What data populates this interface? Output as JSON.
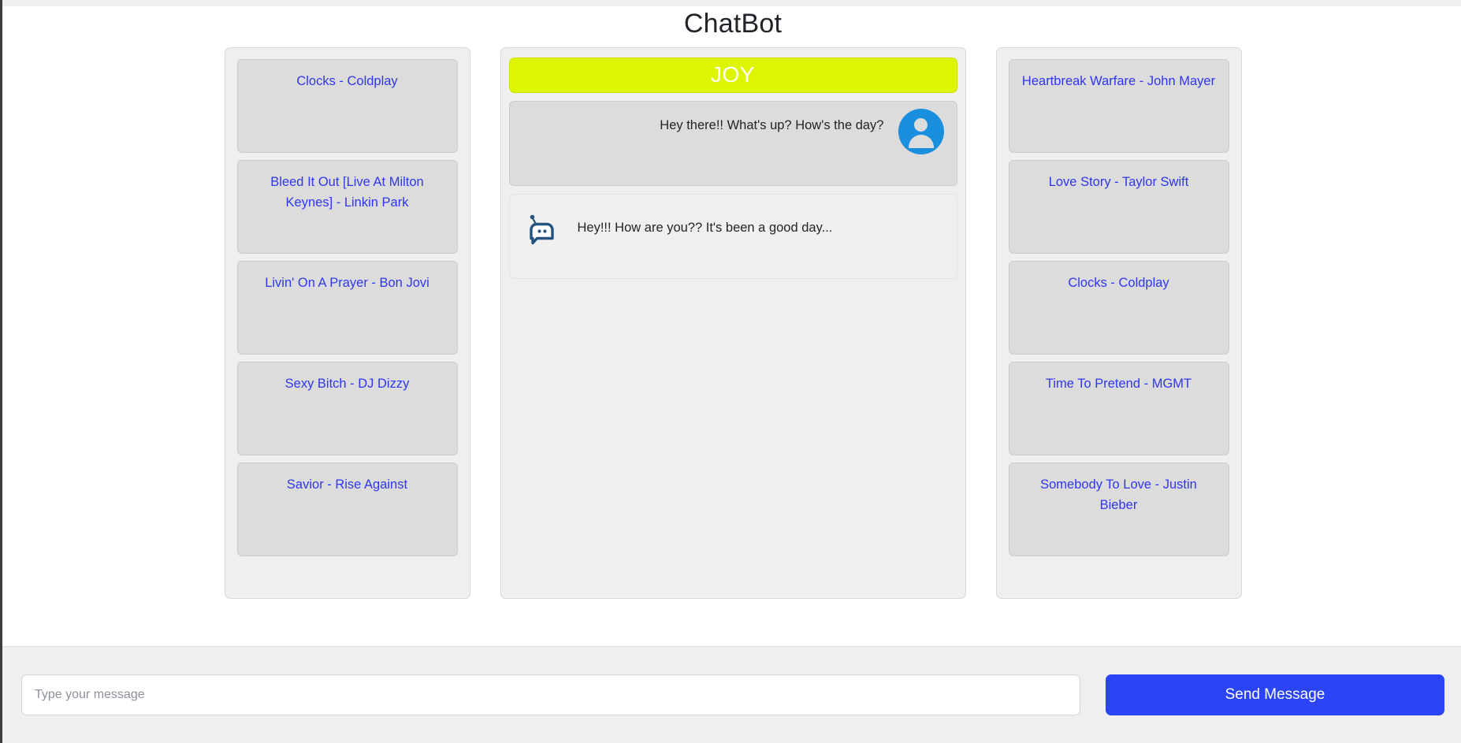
{
  "app": {
    "title": "ChatBot"
  },
  "mood": {
    "label": "JOY",
    "color": "#ddf500"
  },
  "left_playlist": {
    "name": "left-song-list",
    "songs": [
      {
        "label": "Clocks - Coldplay"
      },
      {
        "label": "Bleed It Out [Live At Milton Keynes] - Linkin Park"
      },
      {
        "label": "Livin' On A Prayer - Bon Jovi"
      },
      {
        "label": "Sexy Bitch - DJ Dizzy"
      },
      {
        "label": "Savior - Rise Against"
      }
    ]
  },
  "right_playlist": {
    "name": "right-song-list",
    "songs": [
      {
        "label": "Heartbreak Warfare - John Mayer"
      },
      {
        "label": "Love Story - Taylor Swift"
      },
      {
        "label": "Clocks - Coldplay"
      },
      {
        "label": "Time To Pretend - MGMT"
      },
      {
        "label": "Somebody To Love - Justin Bieber"
      }
    ]
  },
  "chat": {
    "messages": [
      {
        "sender": "user",
        "text": "Hey there!! What's up? How's the day?",
        "icon": "user-avatar-icon"
      },
      {
        "sender": "bot",
        "text": "Hey!!! How are you?? It's been a good day...",
        "icon": "bot-avatar-icon"
      }
    ]
  },
  "composer": {
    "input_value": "",
    "input_placeholder": "Type your message",
    "send_label": "Send Message",
    "send_color": "#2b44f5"
  },
  "colors": {
    "link": "#2f36ef",
    "card": "#dcdcdc",
    "panel": "#efefef",
    "bot_icon": "#24537f"
  }
}
